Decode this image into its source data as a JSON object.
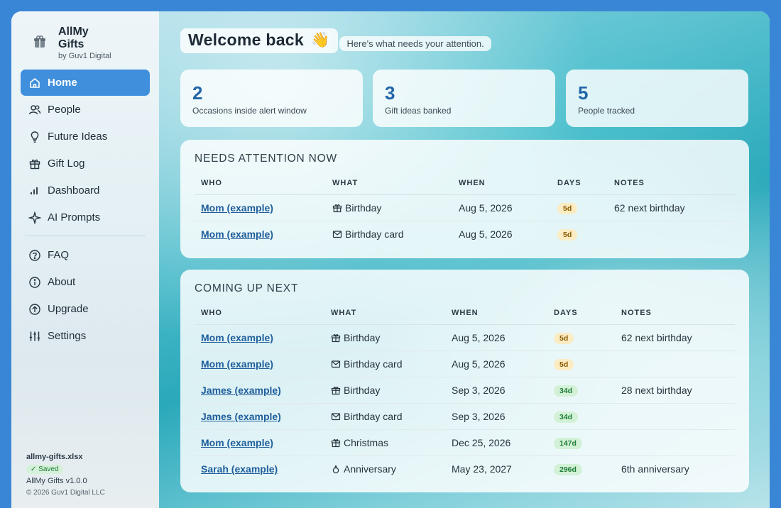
{
  "brand": {
    "title": "AllMy Gifts",
    "subtitle": "by Guv1 Digital"
  },
  "nav": {
    "primary": [
      {
        "label": "Home",
        "icon": "home-icon",
        "active": true
      },
      {
        "label": "People",
        "icon": "people-icon"
      },
      {
        "label": "Future Ideas",
        "icon": "lightbulb-icon"
      },
      {
        "label": "Gift Log",
        "icon": "gift-icon"
      },
      {
        "label": "Dashboard",
        "icon": "bar-chart-icon"
      },
      {
        "label": "AI Prompts",
        "icon": "sparkle-icon"
      }
    ],
    "secondary": [
      {
        "label": "FAQ",
        "icon": "question-icon"
      },
      {
        "label": "About",
        "icon": "info-icon"
      },
      {
        "label": "Upgrade",
        "icon": "arrow-up-circle-icon"
      },
      {
        "label": "Settings",
        "icon": "sliders-icon"
      }
    ]
  },
  "footer": {
    "file": "allmy-gifts.xlsx",
    "saved": "✓ Saved",
    "version": "AllMy Gifts v1.0.0",
    "copyright": "© 2026 Guv1 Digital LLC"
  },
  "welcome": {
    "title": "Welcome back",
    "emoji": "👋",
    "subtitle": "Here's what needs your attention."
  },
  "stats": [
    {
      "value": "2",
      "label": "Occasions inside alert window"
    },
    {
      "value": "3",
      "label": "Gift ideas banked"
    },
    {
      "value": "5",
      "label": "People tracked"
    }
  ],
  "columns": [
    "WHO",
    "WHAT",
    "WHEN",
    "DAYS",
    "NOTES"
  ],
  "needs_attention": {
    "title": "NEEDS ATTENTION NOW",
    "rows": [
      {
        "who": "Mom (example)",
        "what": "Birthday",
        "icon": "gift-icon",
        "when": "Aug 5, 2026",
        "days": "5d",
        "notes": "62 next birthday"
      },
      {
        "who": "Mom (example)",
        "what": "Birthday card",
        "icon": "envelope-icon",
        "when": "Aug 5, 2026",
        "days": "5d",
        "notes": ""
      }
    ]
  },
  "coming_up": {
    "title": "COMING UP NEXT",
    "rows": [
      {
        "who": "Mom (example)",
        "what": "Birthday",
        "icon": "gift-icon",
        "when": "Aug 5, 2026",
        "days": "5d",
        "notes": "62 next birthday"
      },
      {
        "who": "Mom (example)",
        "what": "Birthday card",
        "icon": "envelope-icon",
        "when": "Aug 5, 2026",
        "days": "5d",
        "notes": ""
      },
      {
        "who": "James (example)",
        "what": "Birthday",
        "icon": "gift-icon",
        "when": "Sep 3, 2026",
        "days": "34d",
        "notes": "28 next birthday"
      },
      {
        "who": "James (example)",
        "what": "Birthday card",
        "icon": "envelope-icon",
        "when": "Sep 3, 2026",
        "days": "34d",
        "notes": ""
      },
      {
        "who": "Mom (example)",
        "what": "Christmas",
        "icon": "gift-icon",
        "when": "Dec 25, 2026",
        "days": "147d",
        "notes": ""
      },
      {
        "who": "Sarah (example)",
        "what": "Anniversary",
        "icon": "ring-icon",
        "when": "May 23, 2027",
        "days": "296d",
        "notes": "6th anniversary"
      }
    ]
  }
}
